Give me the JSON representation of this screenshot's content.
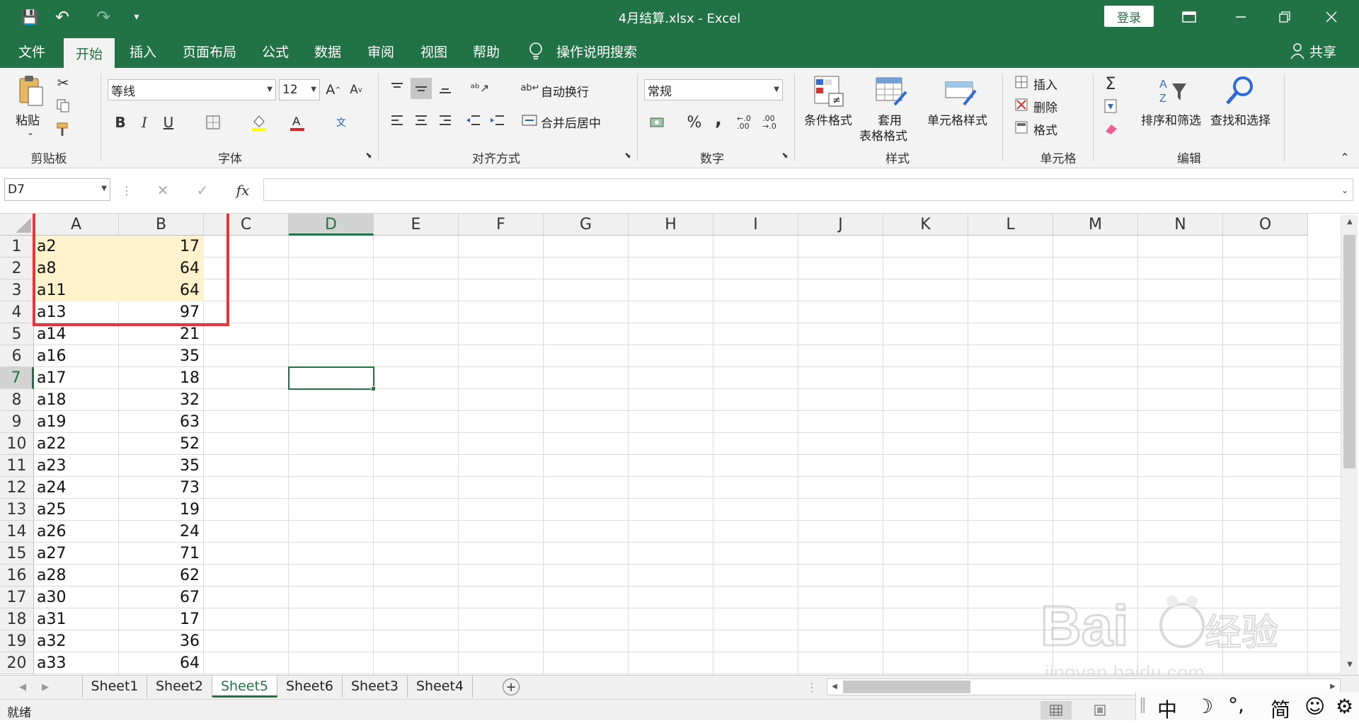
{
  "window": {
    "title": "4月结算.xlsx  -  Excel",
    "login_label": "登录"
  },
  "qat": {
    "save": "💾",
    "undo": "↶",
    "redo": "↷",
    "customize": "▾"
  },
  "ribbon_tabs": [
    "文件",
    "开始",
    "插入",
    "页面布局",
    "公式",
    "数据",
    "审阅",
    "视图",
    "帮助",
    "操作说明搜索"
  ],
  "active_tab": "开始",
  "share_label": "共享",
  "clipboard": {
    "paste": "粘贴",
    "group": "剪贴板"
  },
  "font": {
    "name": "等线",
    "size": "12",
    "bold": "B",
    "italic": "I",
    "underline": "U",
    "group": "字体"
  },
  "alignment": {
    "wrap": "自动换行",
    "merge": "合并后居中",
    "group": "对齐方式"
  },
  "number": {
    "format": "常规",
    "percent": "%",
    "comma": ",",
    "group": "数字"
  },
  "styles": {
    "conditional": "条件格式",
    "table1": "套用",
    "table2": "表格格式",
    "cell_styles": "单元格样式",
    "group": "样式"
  },
  "cells": {
    "insert": "插入",
    "delete": "删除",
    "format": "格式",
    "group": "单元格"
  },
  "editing": {
    "sort": "排序和筛选",
    "find": "查找和选择",
    "group": "编辑"
  },
  "formula_bar": {
    "name_box": "D7",
    "value": "",
    "fx": "fx"
  },
  "columns": [
    "A",
    "B",
    "C",
    "D",
    "E",
    "F",
    "G",
    "H",
    "I",
    "J",
    "K",
    "L",
    "M",
    "N",
    "O"
  ],
  "selected_column": "D",
  "selected_row": 7,
  "rows": [
    {
      "n": "1",
      "a": "a2",
      "b": "17"
    },
    {
      "n": "2",
      "a": "a8",
      "b": "64"
    },
    {
      "n": "3",
      "a": "a11",
      "b": "64"
    },
    {
      "n": "4",
      "a": "a13",
      "b": "97"
    },
    {
      "n": "5",
      "a": "a14",
      "b": "21"
    },
    {
      "n": "6",
      "a": "a16",
      "b": "35"
    },
    {
      "n": "7",
      "a": "a17",
      "b": "18"
    },
    {
      "n": "8",
      "a": "a18",
      "b": "32"
    },
    {
      "n": "9",
      "a": "a19",
      "b": "63"
    },
    {
      "n": "10",
      "a": "a22",
      "b": "52"
    },
    {
      "n": "11",
      "a": "a23",
      "b": "35"
    },
    {
      "n": "12",
      "a": "a24",
      "b": "73"
    },
    {
      "n": "13",
      "a": "a25",
      "b": "19"
    },
    {
      "n": "14",
      "a": "a26",
      "b": "24"
    },
    {
      "n": "15",
      "a": "a27",
      "b": "71"
    },
    {
      "n": "16",
      "a": "a28",
      "b": "62"
    },
    {
      "n": "17",
      "a": "a30",
      "b": "67"
    },
    {
      "n": "18",
      "a": "a31",
      "b": "17"
    },
    {
      "n": "19",
      "a": "a32",
      "b": "36"
    },
    {
      "n": "20",
      "a": "a33",
      "b": "64"
    }
  ],
  "highlighted_rows": [
    1,
    2,
    3
  ],
  "highlight_color": "#fff2cc",
  "sheets": [
    "Sheet1",
    "Sheet2",
    "Sheet5",
    "Sheet6",
    "Sheet3",
    "Sheet4"
  ],
  "active_sheet": "Sheet5",
  "status": {
    "ready": "就绪"
  },
  "ime": [
    "中",
    "☽",
    "°,",
    "简",
    "☺",
    "⚙"
  ],
  "colors": {
    "brand": "#217346",
    "annotation_red": "#e8343a"
  }
}
